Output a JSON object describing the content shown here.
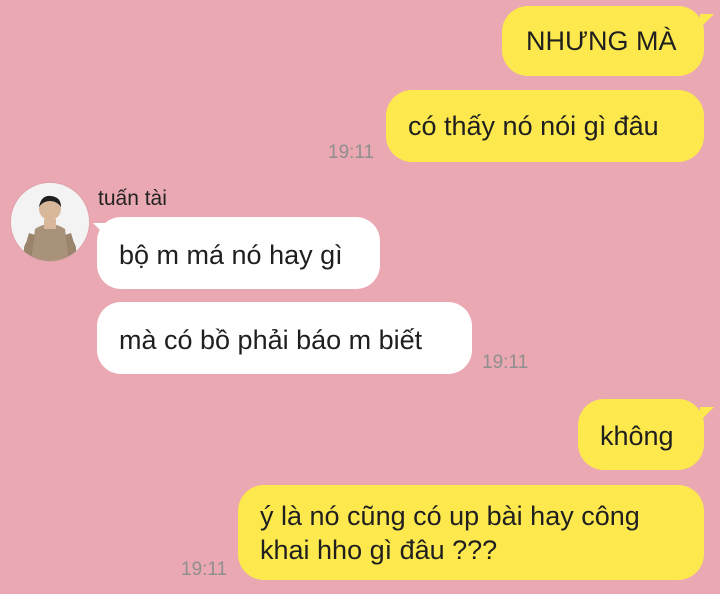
{
  "colors": {
    "background": "#eaa8b2",
    "my_bubble": "#fde94e",
    "their_bubble": "#ffffff",
    "timestamp": "#8f8f8f"
  },
  "contact": {
    "name": "tuấn tài",
    "avatar_icon": "profile-photo"
  },
  "messages": [
    {
      "sender": "me",
      "text": "NHƯNG MÀ"
    },
    {
      "sender": "me",
      "text": "có thấy nó nói gì đâu",
      "time": "19:11"
    },
    {
      "sender": "them",
      "text": "bộ m má nó hay gì"
    },
    {
      "sender": "them",
      "text": "mà có bồ phải báo m biết",
      "time": "19:11"
    },
    {
      "sender": "me",
      "text": "không"
    },
    {
      "sender": "me",
      "text": "ý là nó cũng có up bài hay công khai hho gì đâu ???",
      "time": "19:11"
    }
  ]
}
